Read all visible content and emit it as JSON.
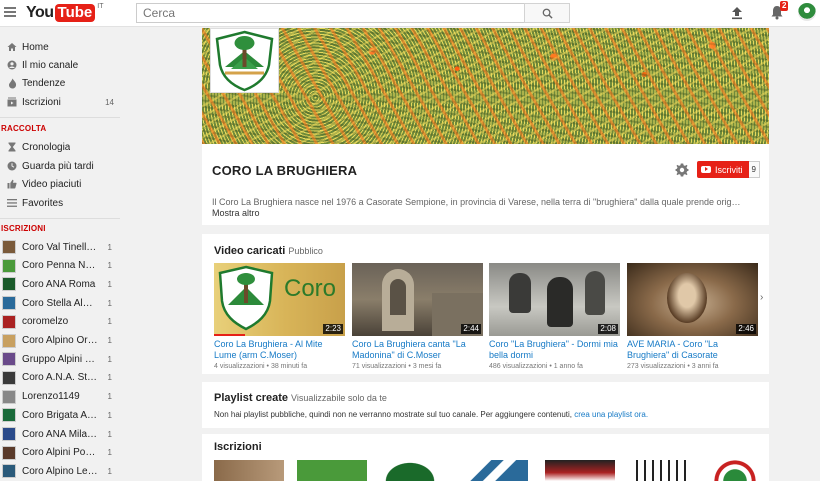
{
  "header": {
    "logo_you": "You",
    "logo_tube": "Tube",
    "logo_country": "IT",
    "search_placeholder": "Cerca",
    "notification_count": "2"
  },
  "sidebar": {
    "nav": [
      {
        "label": "Home",
        "icon": "home-icon"
      },
      {
        "label": "Il mio canale",
        "icon": "user-icon"
      },
      {
        "label": "Tendenze",
        "icon": "flame-icon"
      },
      {
        "label": "Iscrizioni",
        "icon": "subscriptions-icon",
        "count": "14"
      }
    ],
    "section_library": "RACCOLTA",
    "library": [
      {
        "label": "Cronologia",
        "icon": "hourglass-icon"
      },
      {
        "label": "Guarda più tardi",
        "icon": "clock-icon"
      },
      {
        "label": "Video piaciuti",
        "icon": "thumbs-up-icon"
      },
      {
        "label": "Favorites",
        "icon": "list-icon"
      }
    ],
    "section_subs": "ISCRIZIONI",
    "subscriptions": [
      {
        "label": "Coro Val Tinella, ...",
        "count": "1",
        "color": "#7a5a3a"
      },
      {
        "label": "Coro Penna Ner...",
        "count": "1",
        "color": "#4a9a3a"
      },
      {
        "label": "Coro ANA Roma",
        "count": "1",
        "color": "#1a5a2a"
      },
      {
        "label": "Coro Stella Alpin...",
        "count": "1",
        "color": "#2a6a9a"
      },
      {
        "label": "coromelzo",
        "count": "1",
        "color": "#aa2222"
      },
      {
        "label": "Coro Alpino Oro...",
        "count": "1",
        "color": "#c8a060"
      },
      {
        "label": "Gruppo Alpini N...",
        "count": "1",
        "color": "#6a4a8a"
      },
      {
        "label": "Coro A.N.A. Stell...",
        "count": "1",
        "color": "#3a3a3a"
      },
      {
        "label": "Lorenzo1149",
        "count": "1",
        "color": "#888888"
      },
      {
        "label": "Coro Brigata Alp...",
        "count": "1",
        "color": "#1a6a3a"
      },
      {
        "label": "Coro ANA Milano",
        "count": "1",
        "color": "#2a4a8a"
      },
      {
        "label": "Coro Alpini Porr...",
        "count": "1",
        "color": "#5a3a2a"
      },
      {
        "label": "Coro Alpino Lec...",
        "count": "1",
        "color": "#2a5a7a"
      }
    ]
  },
  "channel": {
    "name": "CORO LA BRUGHIERA",
    "logo_text": "CORO LA BRUGHIERA",
    "subscribe_label": "Iscriviti",
    "subscriber_count": "9",
    "description": "Il Coro La Brughiera nasce nel 1976 a Casorate Sempione, in provincia di Varese, nella terra di \"brughiera\" dalla quale prende origine il...",
    "more_label": "Mostra altro"
  },
  "uploads": {
    "title": "Video caricati",
    "subtitle": "Pubblico",
    "videos": [
      {
        "title": "Coro La Brughiera - Al Mite Lume (arm C.Moser)",
        "views": "4 visualizzazioni",
        "age": "38 minuti fa",
        "duration": "2:23",
        "thumb_text": "Coro"
      },
      {
        "title": "Coro La Brughiera canta \"La Madonina\" di C.Moser",
        "views": "71 visualizzazioni",
        "age": "3 mesi fa",
        "duration": "2:44"
      },
      {
        "title": "Coro \"La Brughiera\" - Dormi mia bella dormi",
        "views": "486 visualizzazioni",
        "age": "1 anno fa",
        "duration": "2:08"
      },
      {
        "title": "AVE MARIA - Coro \"La Brughiera\" di Casorate Sempione",
        "views": "273 visualizzazioni",
        "age": "3 anni fa",
        "duration": "2:46"
      }
    ]
  },
  "playlists": {
    "title": "Playlist create",
    "subtitle": "Visualizzabile solo da te",
    "message": "Non hai playlist pubbliche, quindi non ne verranno mostrate sul tuo canale. Per aggiungere contenuti,",
    "link": "crea una playlist ora."
  },
  "subs_section": {
    "title": "Iscrizioni"
  }
}
